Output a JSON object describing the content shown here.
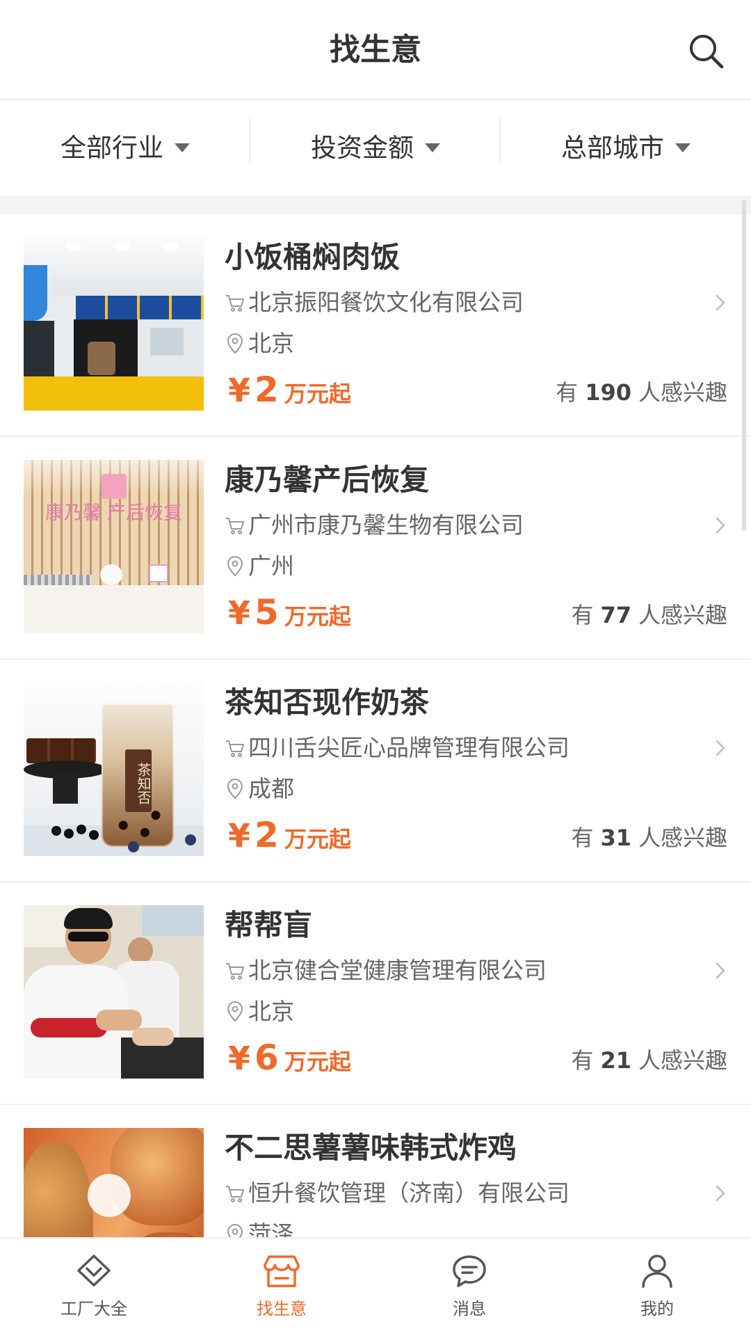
{
  "header": {
    "title": "找生意"
  },
  "icons": {
    "search": "search-icon",
    "dropdown": "triangle-down-icon",
    "cart": "cart-icon",
    "location": "location-pin-icon",
    "chevron": "chevron-right-icon"
  },
  "filters": [
    {
      "label": "全部行业"
    },
    {
      "label": "投资金额"
    },
    {
      "label": "总部城市"
    }
  ],
  "listings": [
    {
      "name": "小饭桶焖肉饭",
      "company": "北京振阳餐饮文化有限公司",
      "city": "北京",
      "price_symbol": "¥",
      "price_amount": "2",
      "price_unit": "万元起",
      "interest_prefix": "有",
      "interest_count": "190",
      "interest_suffix": "人感兴趣"
    },
    {
      "name": "康乃馨产后恢复",
      "company": "广州市康乃馨生物有限公司",
      "city": "广州",
      "price_symbol": "¥",
      "price_amount": "5",
      "price_unit": "万元起",
      "interest_prefix": "有",
      "interest_count": "77",
      "interest_suffix": "人感兴趣",
      "image_sign": [
        "康乃馨",
        "产后恢复"
      ]
    },
    {
      "name": "茶知否现作奶茶",
      "company": "四川舌尖匠心品牌管理有限公司",
      "city": "成都",
      "price_symbol": "¥",
      "price_amount": "2",
      "price_unit": "万元起",
      "interest_prefix": "有",
      "interest_count": "31",
      "interest_suffix": "人感兴趣",
      "image_sign": "茶知否"
    },
    {
      "name": "帮帮盲",
      "company": "北京健合堂健康管理有限公司",
      "city": "北京",
      "price_symbol": "¥",
      "price_amount": "6",
      "price_unit": "万元起",
      "interest_prefix": "有",
      "interest_count": "21",
      "interest_suffix": "人感兴趣"
    },
    {
      "name": "不二思薯薯味韩式炸鸡",
      "company": "恒升餐饮管理（济南）有限公司",
      "city": "菏泽"
    }
  ],
  "tabbar": {
    "tabs": [
      {
        "label": "工厂大全",
        "icon": "diamond-icon",
        "active": false
      },
      {
        "label": "找生意",
        "icon": "shop-icon",
        "active": true
      },
      {
        "label": "消息",
        "icon": "chat-icon",
        "active": false
      },
      {
        "label": "我的",
        "icon": "user-icon",
        "active": false
      }
    ]
  },
  "colors": {
    "accent": "#F0692A",
    "primary_text": "#333333",
    "secondary_text": "#666666",
    "divider": "#F0F0F0",
    "band": "#F3F3F3",
    "inactive_tab": "#555555"
  }
}
